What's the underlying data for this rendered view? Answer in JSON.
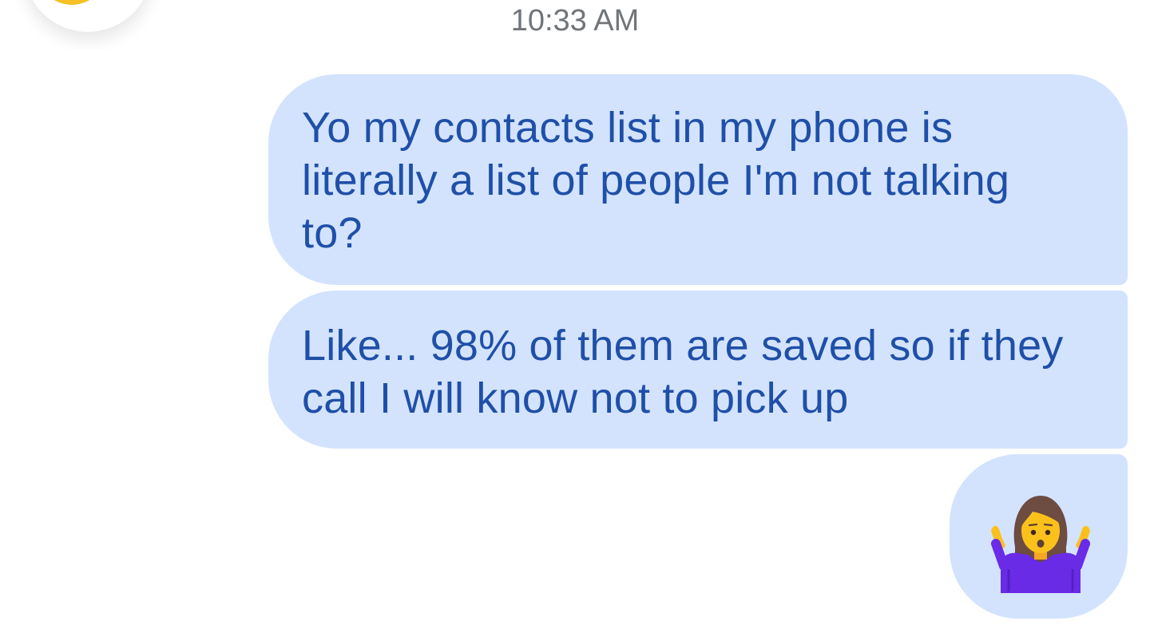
{
  "conversation": {
    "timestamp": "10:33 AM",
    "messages": [
      {
        "direction": "outgoing",
        "text": "Yo my contacts list in my phone is\nliterally a list of people I'm not talking\nto?"
      },
      {
        "direction": "outgoing",
        "text": "Like... 98% of them are saved so if they\ncall I will know not to pick up"
      },
      {
        "direction": "outgoing",
        "emoji": "woman-shrugging-emoji"
      }
    ]
  },
  "colors": {
    "bubble_background": "#d3e3fd",
    "bubble_text": "#1f4fa8",
    "timestamp_text": "#70757a",
    "avatar_accent": "#f6c026"
  }
}
